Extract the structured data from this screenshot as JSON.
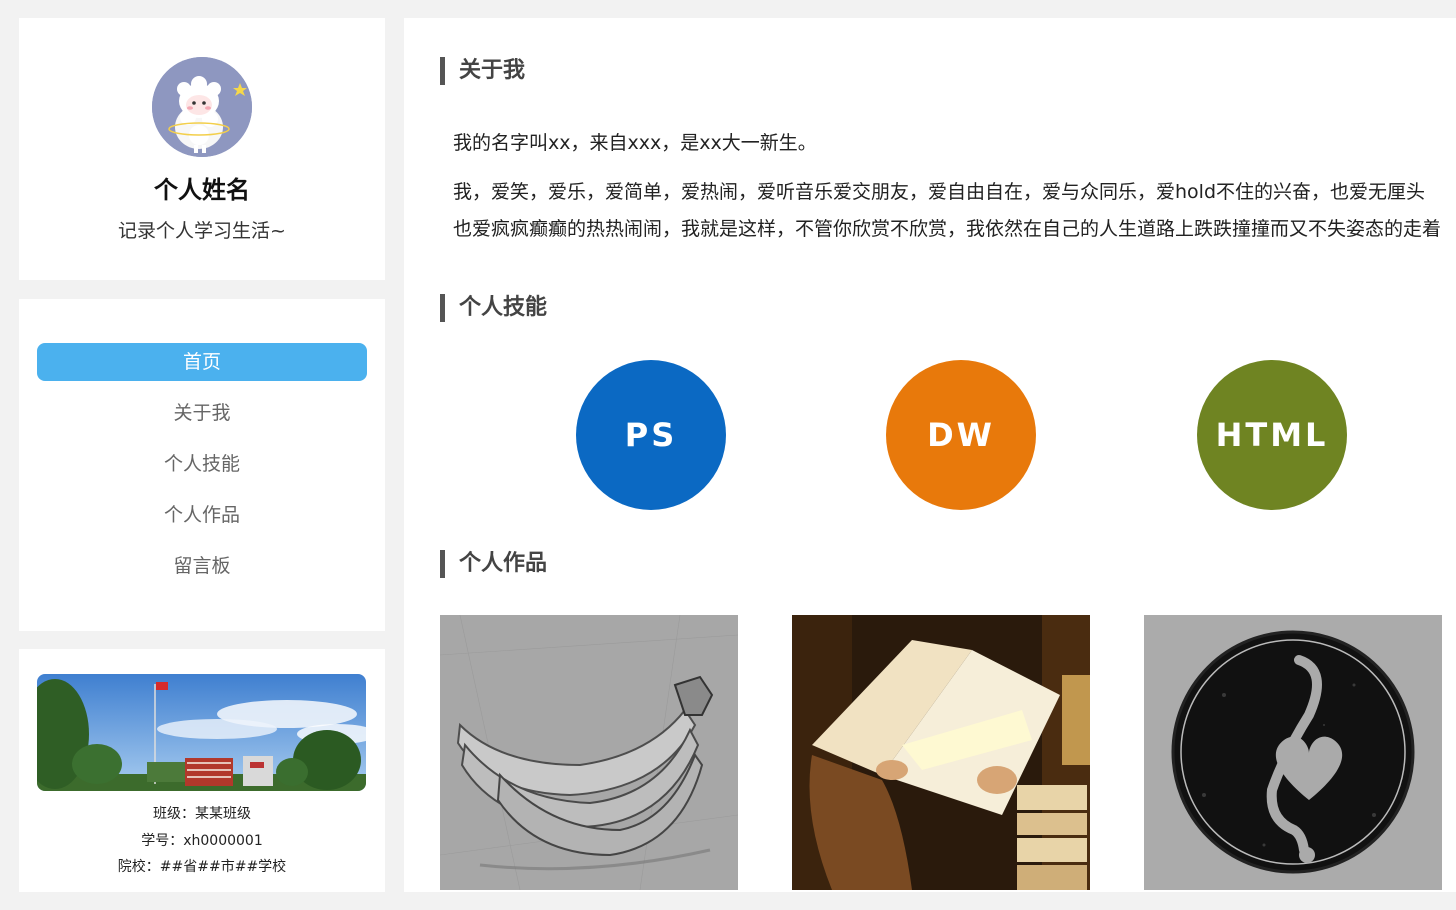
{
  "profile": {
    "name": "个人姓名",
    "motto": "记录个人学习生活~"
  },
  "nav": {
    "items": [
      {
        "label": "首页",
        "active": true
      },
      {
        "label": "关于我",
        "active": false
      },
      {
        "label": "个人技能",
        "active": false
      },
      {
        "label": "个人作品",
        "active": false
      },
      {
        "label": "留言板",
        "active": false
      }
    ]
  },
  "school": {
    "class_line": "班级：某某班级",
    "id_line": "学号：xh0000001",
    "school_line": "院校：##省##市##学校"
  },
  "about": {
    "title": "关于我",
    "line1": "我的名字叫xx，来自xxx，是xx大一新生。",
    "line2": "我，爱笑，爱乐，爱简单，爱热闹，爱听音乐爱交朋友，爱自由自在，爱与众同乐，爱hold不住的兴奋，也爱无厘头",
    "line3": "也爱疯疯癫癫的热热闹闹，我就是这样，不管你欣赏不欣赏，我依然在自己的人生道路上跌跌撞撞而又不失姿态的走着"
  },
  "skills": {
    "title": "个人技能",
    "items": [
      {
        "label": "PS",
        "color": "#0b69c3"
      },
      {
        "label": "DW",
        "color": "#e8790b"
      },
      {
        "label": "HTML",
        "color": "#6f8422"
      }
    ]
  },
  "works": {
    "title": "个人作品",
    "items": [
      {
        "icon": "banana-sketch-image"
      },
      {
        "icon": "reading-book-image"
      },
      {
        "icon": "music-heart-note-image"
      }
    ]
  },
  "colors": {
    "accent": "#4bb1ee",
    "background": "#f2f2f2"
  }
}
